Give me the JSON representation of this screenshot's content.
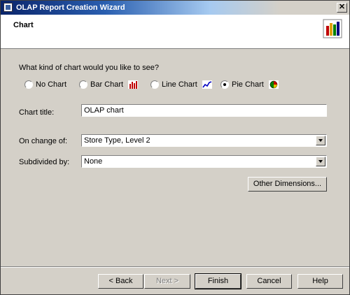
{
  "window": {
    "title": "OLAP Report Creation Wizard",
    "close_glyph": "✕"
  },
  "header": {
    "title": "Chart"
  },
  "question": "What kind of chart would you like to see?",
  "chart_types": [
    {
      "label": "No Chart",
      "selected": false,
      "icon": ""
    },
    {
      "label": "Bar Chart",
      "selected": false,
      "icon": "bar-chart-icon"
    },
    {
      "label": "Line Chart",
      "selected": false,
      "icon": "line-chart-icon"
    },
    {
      "label": "Pie Chart",
      "selected": true,
      "icon": "pie-chart-icon"
    }
  ],
  "fields": {
    "chart_title": {
      "label": "Chart title:",
      "value": "OLAP chart"
    },
    "on_change_of": {
      "label": "On change of:",
      "value": "Store Type, Level 2"
    },
    "subdivided_by": {
      "label": "Subdivided by:",
      "value": "None"
    }
  },
  "buttons": {
    "other_dimensions": "Other Dimensions...",
    "back": "< Back",
    "next": "Next >",
    "finish": "Finish",
    "cancel": "Cancel",
    "help": "Help"
  }
}
